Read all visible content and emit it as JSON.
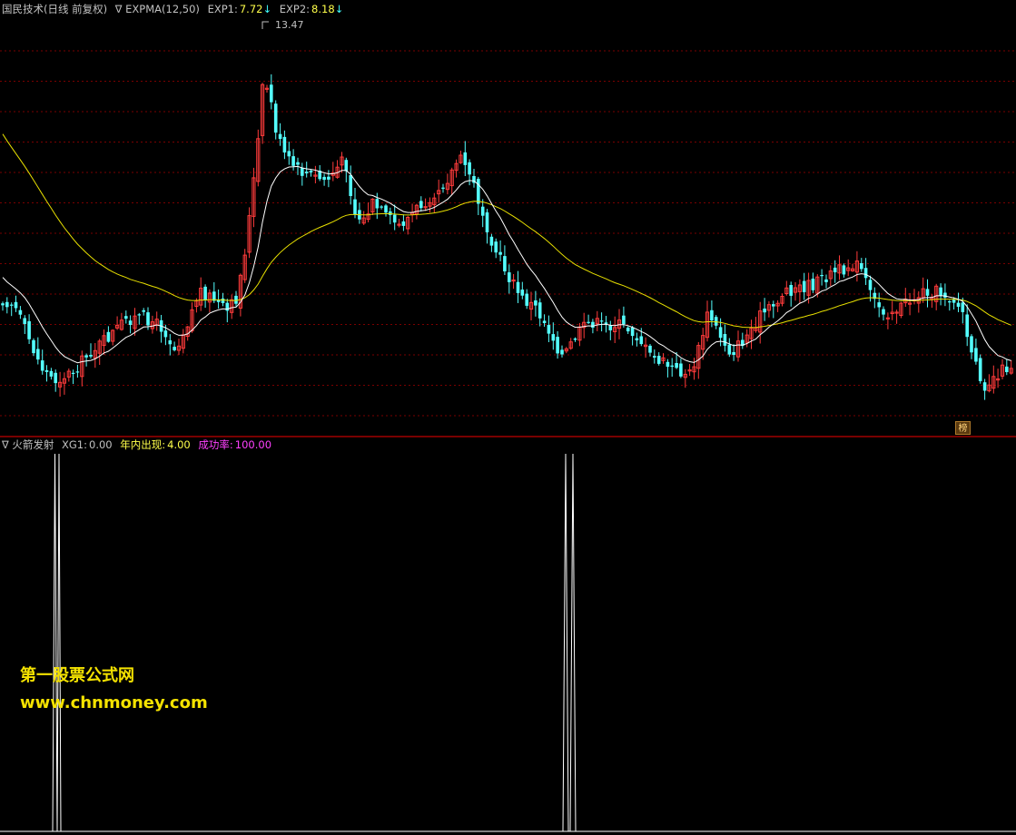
{
  "upper_panel": {
    "stock_name": "国民技术",
    "period_note": "(日线 前复权)",
    "indicator_name": "∇ EXPMA(12,50)",
    "exp1_label": "EXP1:",
    "exp1_value": "7.72",
    "exp1_arrow": "↓",
    "exp2_label": "EXP2:",
    "exp2_value": "8.18",
    "exp2_arrow": "↓",
    "peak_label": "13.47",
    "badge_text": "榜",
    "colors": {
      "up": "#ff3b3b",
      "down": "#54ffff",
      "exp1": "#ffffff",
      "exp2": "#e8e000",
      "grid": "#7a0000",
      "border": "#a00000",
      "header_text": "#c0c0c0",
      "value": "#ffff4a",
      "arrow": "#40ffff"
    }
  },
  "lower_panel": {
    "indicator_name": "∇ 火箭发射",
    "xg1_label": "XG1:",
    "xg1_value": "0.00",
    "year_label": "年内出现:",
    "year_value": "4.00",
    "success_label": "成功率:",
    "success_value": "100.00",
    "colors": {
      "spike": "#ffffff",
      "year": "#ffff4a",
      "success": "#ff40ff"
    }
  },
  "watermark": {
    "line1": "第一股票公式网",
    "line2": "www.chnmoney.com",
    "color": "#f4e200"
  },
  "chart_data": [
    {
      "type": "candlestick",
      "y_high": 13.47,
      "series": [
        {
          "name": "EXP1"
        },
        {
          "name": "EXP2"
        }
      ],
      "grid": true
    },
    {
      "type": "line",
      "series": [
        {
          "name": "XG1",
          "signal_days": 4
        }
      ],
      "grid": false
    }
  ]
}
